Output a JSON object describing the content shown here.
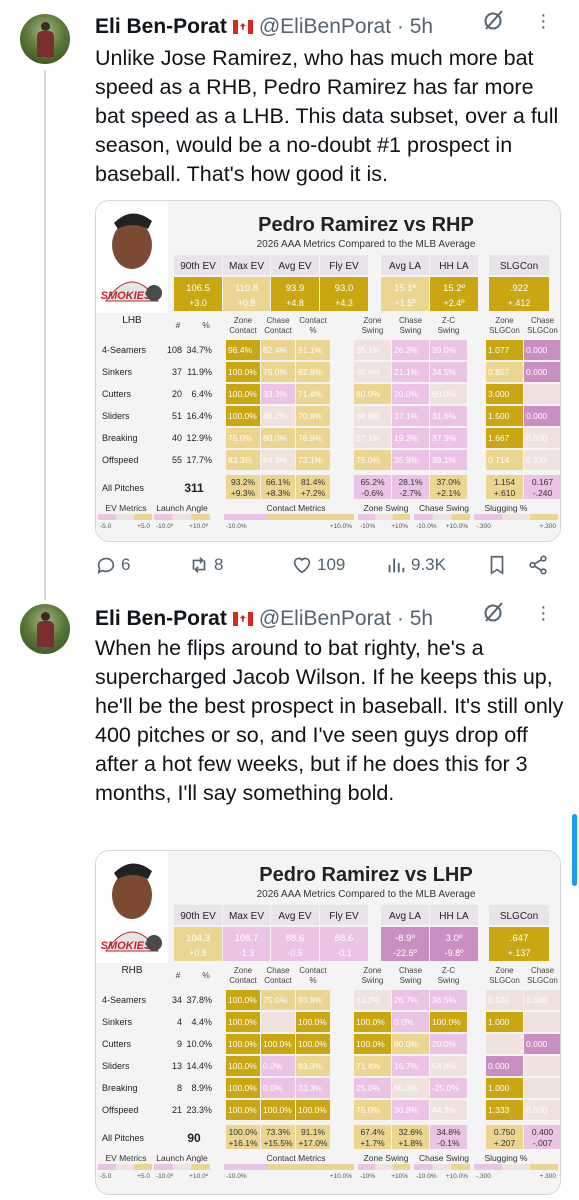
{
  "tweets": [
    {
      "author": {
        "name": "Eli Ben-Porat",
        "handle": "@EliBenPorat",
        "time": "5h"
      },
      "text": "Unlike Jose Ramirez, who has much more bat speed as a RHB, Pedro Ramirez has far more bat speed as a LHB. This data subset, over a full season, would be a no-doubt #1 prospect in baseball. That's how good it is.",
      "stats": {
        "replies": "6",
        "reposts": "8",
        "likes": "109",
        "views": "9.3K"
      },
      "card": {
        "title": "Pedro Ramirez vs RHP",
        "subtitle": "2026 AAA Metrics Compared to the MLB Average",
        "team_logo": "SMOKIES",
        "top_headers": [
          "90th EV",
          "Max EV",
          "Avg EV",
          "Fly EV",
          "Avg LA",
          "HH LA",
          "SLGCon"
        ],
        "top_values": [
          "106.5",
          "110.8",
          "93.9",
          "93.0",
          "15.1º",
          "15.2º",
          ".922"
        ],
        "top_deltas": [
          "+3.0",
          "+0.8",
          "+4.8",
          "+4.3",
          "+1.5º",
          "+2.4º",
          "+.412"
        ],
        "hand": "LHB",
        "col_headers": [
          "#",
          "%",
          "Zone Contact",
          "Chase Contact",
          "Contact %",
          "Zone Swing",
          "Chase Swing",
          "Z-C Swing",
          "Zone SLGCon",
          "Chase SLGCon"
        ],
        "rows": [
          {
            "label": "4-Seamers",
            "n": "108",
            "pct": "34.7%",
            "cells": [
              "96.4%",
              "82.4%",
              "91.1%",
              "65.1%",
              "26.2%",
              "39.0%",
              "1.077",
              "0.000"
            ]
          },
          {
            "label": "Sinkers",
            "n": "37",
            "pct": "11.9%",
            "cells": [
              "100.0%",
              "75.0%",
              "92.9%",
              "55.6%",
              "21.1%",
              "34.5%",
              "0.857",
              "0.000"
            ]
          },
          {
            "label": "Cutters",
            "n": "20",
            "pct": "6.4%",
            "cells": [
              "100.0%",
              "33.3%",
              "71.4%",
              "80.0%",
              "20.0%",
              "60.0%",
              "3.000",
              ""
            ]
          },
          {
            "label": "Sliders",
            "n": "51",
            "pct": "16.4%",
            "cells": [
              "100.0%",
              "46.2%",
              "70.8%",
              "68.8%",
              "37.1%",
              "31.6%",
              "1.500",
              "0.000"
            ]
          },
          {
            "label": "Breaking",
            "n": "40",
            "pct": "12.9%",
            "cells": [
              "75.0%",
              "80.0%",
              "76.9%",
              "57.1%",
              "19.2%",
              "37.9%",
              "1.667",
              "0.500"
            ]
          },
          {
            "label": "Offspeed",
            "n": "55",
            "pct": "17.7%",
            "cells": [
              "83.3%",
              "64.3%",
              "73.1%",
              "75.0%",
              "35.9%",
              "39.1%",
              "0.714",
              "0.333"
            ]
          }
        ],
        "all": {
          "label": "All Pitches",
          "n": "311",
          "cells": [
            "93.2%",
            "66.1%",
            "81.4%",
            "65.2%",
            "28.1%",
            "37.0%",
            "1.154",
            "0.167"
          ],
          "deltas": [
            "+9.3%",
            "+8.3%",
            "+7.2%",
            "-0.6%",
            "-2.7%",
            "+2.1%",
            "+.610",
            "-.240"
          ]
        },
        "legend": [
          "EV Metrics",
          "Launch Angle",
          "Contact Metrics",
          "Zone Swing",
          "Chase Swing",
          "Slugging %"
        ],
        "legend_ticks": [
          "-5.0",
          "+5.0",
          "-10.0º",
          "+10.0º",
          "-10.0%",
          "+10.0%",
          "-10%",
          "+10%",
          "-10.0%",
          "+10.0%",
          "-.300",
          "+.300"
        ]
      }
    },
    {
      "author": {
        "name": "Eli Ben-Porat",
        "handle": "@EliBenPorat",
        "time": "5h"
      },
      "text": "When he flips around to bat righty, he's a supercharged Jacob Wilson. If he keeps this up, he'll be the best prospect in baseball. It's still only 400 pitches or so, and I've seen guys drop off after a hot few weeks, but if he does this for 3 months, I'll say something bold.",
      "card": {
        "title": "Pedro Ramirez vs LHP",
        "subtitle": "2026 AAA Metrics Compared to the MLB Average",
        "team_logo": "SMOKIES",
        "top_headers": [
          "90th EV",
          "Max EV",
          "Avg EV",
          "Fly EV",
          "Avg LA",
          "HH LA",
          "SLGCon"
        ],
        "top_values": [
          "104.3",
          "108.7",
          "88.6",
          "88.6",
          "-8.9º",
          "3.0º",
          ".647"
        ],
        "top_deltas": [
          "+0.8",
          "-1.3",
          "-0.5",
          "-0.1",
          "-22.6º",
          "-9.8º",
          "+.137"
        ],
        "hand": "RHB",
        "col_headers": [
          "#",
          "%",
          "Zone Contact",
          "Chase Contact",
          "Contact %",
          "Zone Swing",
          "Chase Swing",
          "Z-C Swing",
          "Zone SLGCon",
          "Chase SLGCon"
        ],
        "rows": [
          {
            "label": "4-Seamers",
            "n": "34",
            "pct": "37.8%",
            "cells": [
              "100.0%",
              "75.0%",
              "93.8%",
              "63.2%",
              "26.7%",
              "36.5%",
              "0.500",
              "0.500"
            ]
          },
          {
            "label": "Sinkers",
            "n": "4",
            "pct": "4.4%",
            "cells": [
              "100.0%",
              "",
              "100.0%",
              "100.0%",
              "0.0%",
              "100.0%",
              "1.000",
              ""
            ]
          },
          {
            "label": "Cutters",
            "n": "9",
            "pct": "10.0%",
            "cells": [
              "100.0%",
              "100.0%",
              "100.0%",
              "100.0%",
              "80.0%",
              "20.0%",
              "",
              "0.000"
            ]
          },
          {
            "label": "Sliders",
            "n": "13",
            "pct": "14.4%",
            "cells": [
              "100.0%",
              "0.0%",
              "83.3%",
              "71.4%",
              "16.7%",
              "54.8%",
              "0.000",
              ""
            ]
          },
          {
            "label": "Breaking",
            "n": "8",
            "pct": "8.9%",
            "cells": [
              "100.0%",
              "0.0%",
              "33.3%",
              "25.0%",
              "50.0%",
              "-25.0%",
              "1.000",
              ""
            ]
          },
          {
            "label": "Offspeed",
            "n": "21",
            "pct": "23.3%",
            "cells": [
              "100.0%",
              "100.0%",
              "100.0%",
              "75.0%",
              "30.8%",
              "44.2%",
              "1.333",
              "0.500"
            ]
          }
        ],
        "all": {
          "label": "All Pitches",
          "n": "90",
          "cells": [
            "100.0%",
            "73.3%",
            "91.1%",
            "67.4%",
            "32.6%",
            "34.8%",
            "0.750",
            "0.400"
          ],
          "deltas": [
            "+16.1%",
            "+15.5%",
            "+17.0%",
            "+1.7%",
            "+1.8%",
            "-0.1%",
            "+.207",
            "-.007"
          ]
        },
        "legend": [
          "EV Metrics",
          "Launch Angle",
          "Contact Metrics",
          "Zone Swing",
          "Chase Swing",
          "Slugging %"
        ],
        "legend_ticks": [
          "-5.0",
          "+5.0",
          "-10.0º",
          "+10.0º",
          "-10.0%",
          "+10.0%",
          "-10%",
          "+10%",
          "-10.0%",
          "+10.0%",
          "-.300",
          "+.300"
        ]
      }
    }
  ]
}
